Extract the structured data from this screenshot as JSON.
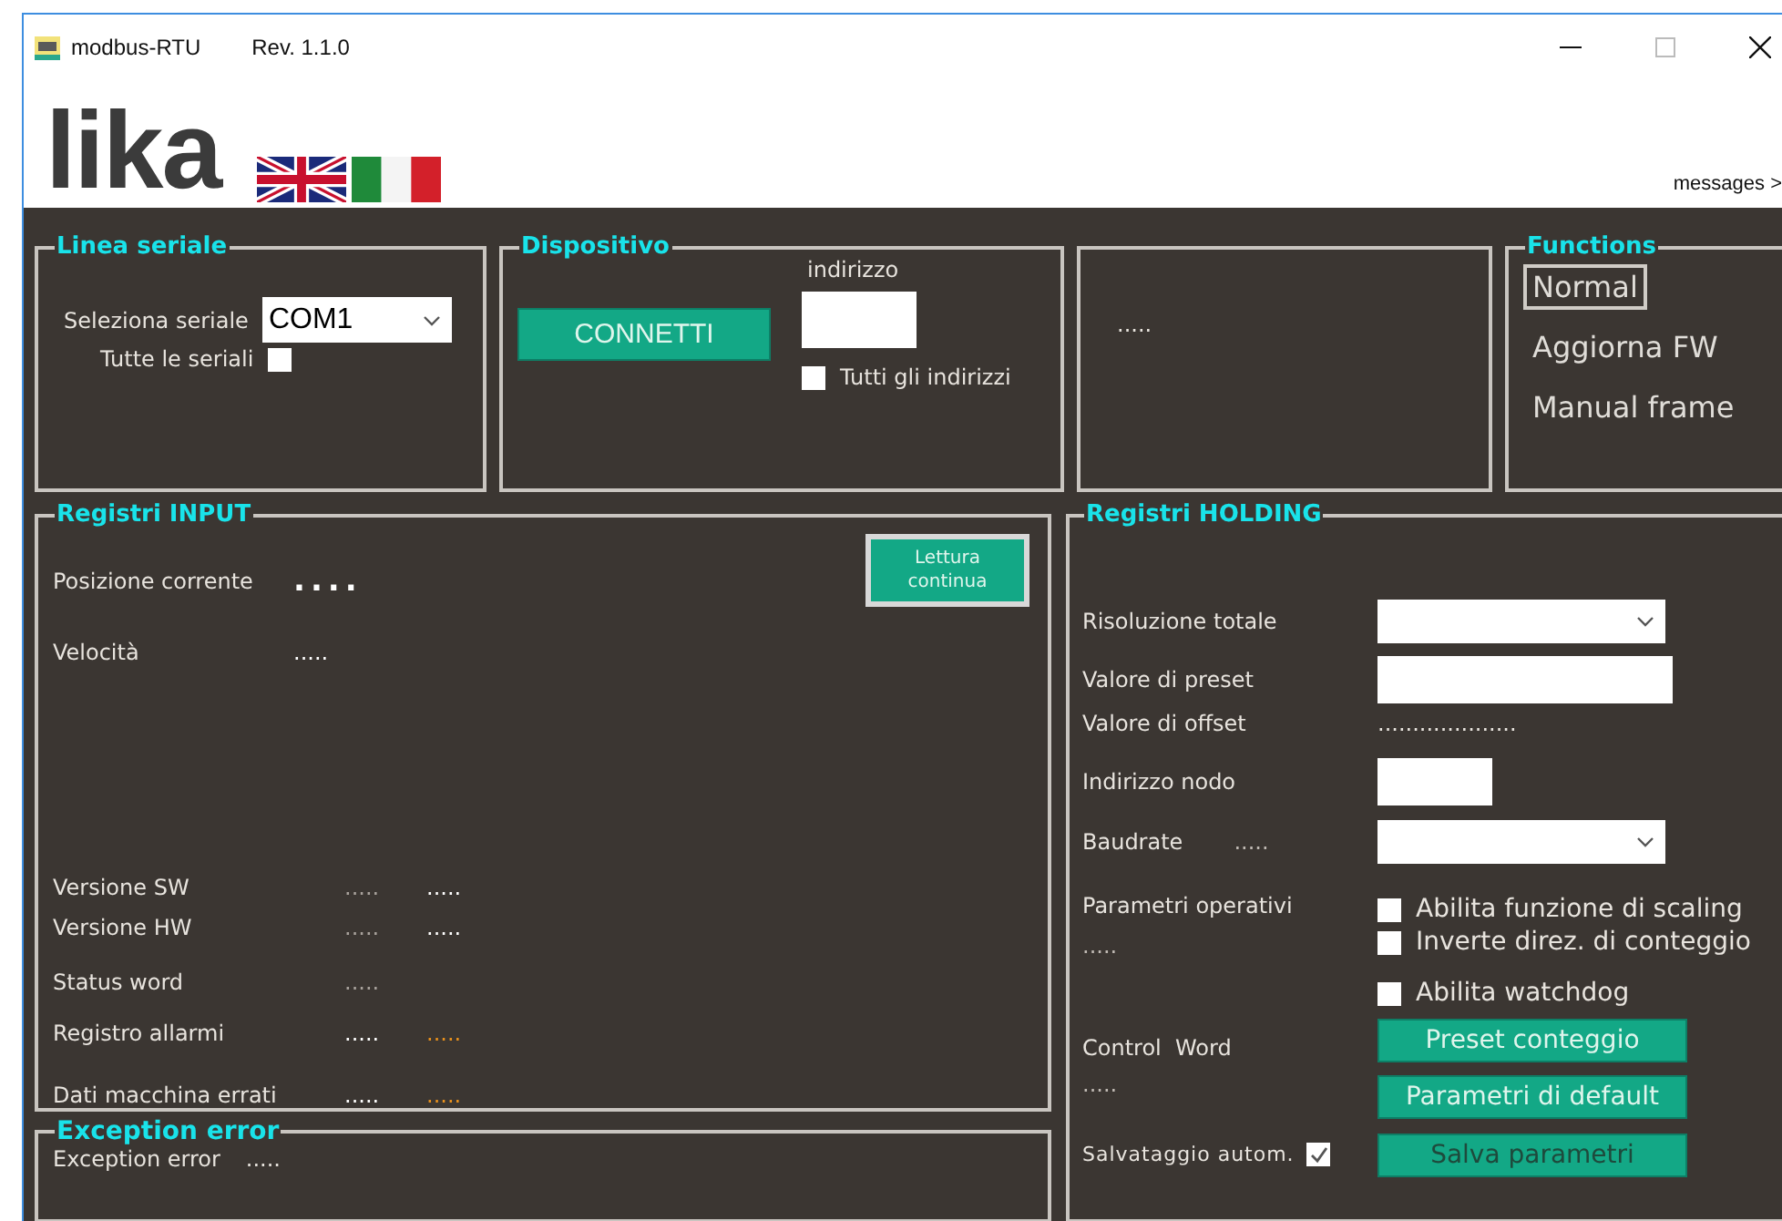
{
  "window": {
    "title": "modbus-RTU",
    "revision": "Rev. 1.1.0"
  },
  "header": {
    "logo": "lika",
    "messages_link": "messages >"
  },
  "linea_seriale": {
    "title": "Linea seriale",
    "port_label": "Seleziona seriale",
    "port_value": "COM1",
    "all_label": "Tutte le seriali",
    "all_checked": false
  },
  "dispositivo": {
    "title": "Dispositivo",
    "connect_button": "CONNETTI",
    "address_label": "indirizzo",
    "all_label": "Tutti gli indirizzi",
    "all_checked": false
  },
  "status_box": {
    "text": "....."
  },
  "functions": {
    "title": "Functions",
    "items": [
      {
        "label": "Normal",
        "selected": true
      },
      {
        "label": "Aggiorna FW",
        "selected": false
      },
      {
        "label": "Manual frame",
        "selected": false
      }
    ]
  },
  "registri_input": {
    "title": "Registri INPUT",
    "button": "Lettura continua",
    "rows": [
      {
        "label": "Posizione corrente",
        "kind": "large",
        "values": [
          {
            "text": "....",
            "color": "#ffffff"
          }
        ]
      },
      {
        "label": "Velocità",
        "kind": "single",
        "values": [
          {
            "text": ".....",
            "color": "#ffffff"
          }
        ]
      },
      {
        "label": "Versione SW",
        "kind": "plain",
        "values": [
          {
            "text": ".....",
            "color": "#a8a29c"
          },
          {
            "text": ".....",
            "color": "#ffffff"
          }
        ]
      },
      {
        "label": "Versione HW",
        "kind": "plain",
        "values": [
          {
            "text": ".....",
            "color": "#a8a29c"
          },
          {
            "text": ".....",
            "color": "#ffffff"
          }
        ]
      },
      {
        "label": "Status word",
        "kind": "plain",
        "values": [
          {
            "text": ".....",
            "color": "#a8a29c"
          }
        ]
      },
      {
        "label": "Registro allarmi",
        "kind": "plain",
        "values": [
          {
            "text": ".....",
            "color": "#ffffff"
          },
          {
            "text": ".....",
            "color": "#e8901c"
          }
        ]
      },
      {
        "label": "Dati macchina errati",
        "kind": "plain",
        "values": [
          {
            "text": ".....",
            "color": "#ffffff"
          },
          {
            "text": ".....",
            "color": "#e8901c"
          }
        ]
      }
    ]
  },
  "exception": {
    "title": "Exception error",
    "label": "Exception error",
    "value": "....."
  },
  "registri_holding": {
    "title": "Registri HOLDING",
    "risoluzione_label": "Risoluzione totale",
    "preset_label": "Valore di preset",
    "offset_label": "Valore di offset",
    "offset_value": "....................",
    "nodo_label": "Indirizzo nodo",
    "baudrate_label": "Baudrate",
    "baudrate_value": ".....",
    "parametri_label": "Parametri operativi",
    "parametri_value": ".....",
    "options": [
      {
        "label": "Abilita funzione di scaling",
        "checked": false
      },
      {
        "label": "Inverte direz. di conteggio",
        "checked": false
      },
      {
        "label": "Abilita watchdog",
        "checked": false
      }
    ],
    "control_label": "Control  Word",
    "control_value": ".....",
    "buttons": [
      {
        "label": "Preset conteggio",
        "disabled": false
      },
      {
        "label": "Parametri di default",
        "disabled": false
      },
      {
        "label": "Salva parametri",
        "disabled": true
      }
    ],
    "autosave_label": "Salvataggio autom.",
    "autosave_checked": true
  }
}
